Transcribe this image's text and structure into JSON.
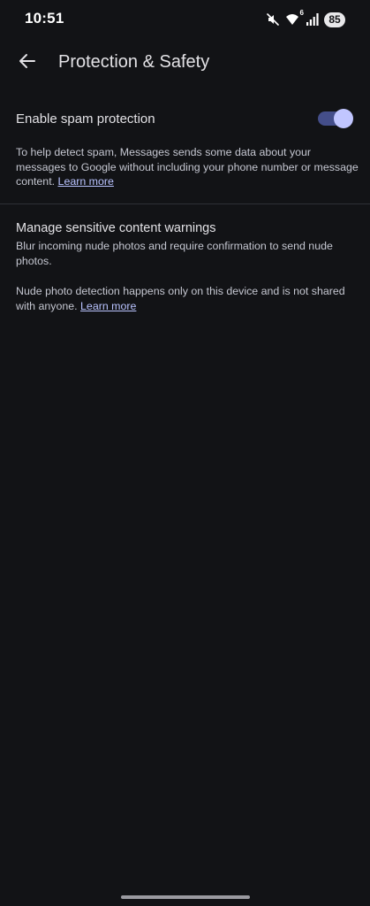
{
  "status_bar": {
    "time": "10:51",
    "battery": "85",
    "icons": [
      "mute-icon",
      "wifi-6-icon",
      "signal-icon",
      "battery-icon"
    ],
    "wifi_badge": "6"
  },
  "app_bar": {
    "title": "Protection & Safety",
    "back_icon": "arrow-back-icon"
  },
  "spam": {
    "title": "Enable spam protection",
    "enabled": true,
    "description": "To help detect spam, Messages sends some data about your messages to Google without including your phone number or message content.",
    "link": "Learn more"
  },
  "sensitive": {
    "title": "Manage sensitive content warnings",
    "description": "Blur incoming nude photos and require confirmation to send nude photos.",
    "detection_text": "Nude photo detection happens only on this device and is not shared with anyone.",
    "link": "Learn more"
  },
  "colors": {
    "background": "#121316",
    "accent": "#c1c6ff",
    "toggle_track": "#444e8a",
    "link": "#b9c3ff"
  }
}
